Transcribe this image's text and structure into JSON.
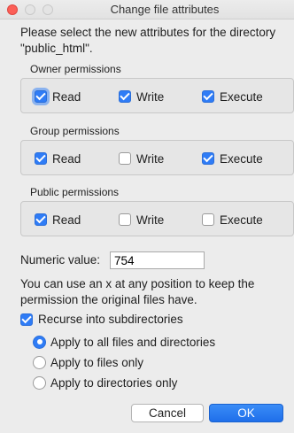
{
  "window": {
    "title": "Change file attributes"
  },
  "intro_text": "Please select the new attributes for the directory \"public_html\".",
  "groups": [
    {
      "label": "Owner permissions",
      "read": "Read",
      "write": "Write",
      "execute": "Execute",
      "read_checked": true,
      "write_checked": true,
      "execute_checked": true
    },
    {
      "label": "Group permissions",
      "read": "Read",
      "write": "Write",
      "execute": "Execute",
      "read_checked": true,
      "write_checked": false,
      "execute_checked": true
    },
    {
      "label": "Public permissions",
      "read": "Read",
      "write": "Write",
      "execute": "Execute",
      "read_checked": true,
      "write_checked": false,
      "execute_checked": false
    }
  ],
  "numeric": {
    "label": "Numeric value:",
    "value": "754"
  },
  "hint_line1": "You can use an x at any position to keep the",
  "hint_line2": "permission the original files have.",
  "recurse": {
    "label": "Recurse into subdirectories",
    "checked": true
  },
  "apply_options": [
    {
      "label": "Apply to all files and directories",
      "selected": true
    },
    {
      "label": "Apply to files only",
      "selected": false
    },
    {
      "label": "Apply to directories only",
      "selected": false
    }
  ],
  "buttons": {
    "cancel": "Cancel",
    "ok": "OK"
  },
  "colors": {
    "accent": "#2f7cf6",
    "close": "#fc5f57",
    "background": "#ececec"
  }
}
